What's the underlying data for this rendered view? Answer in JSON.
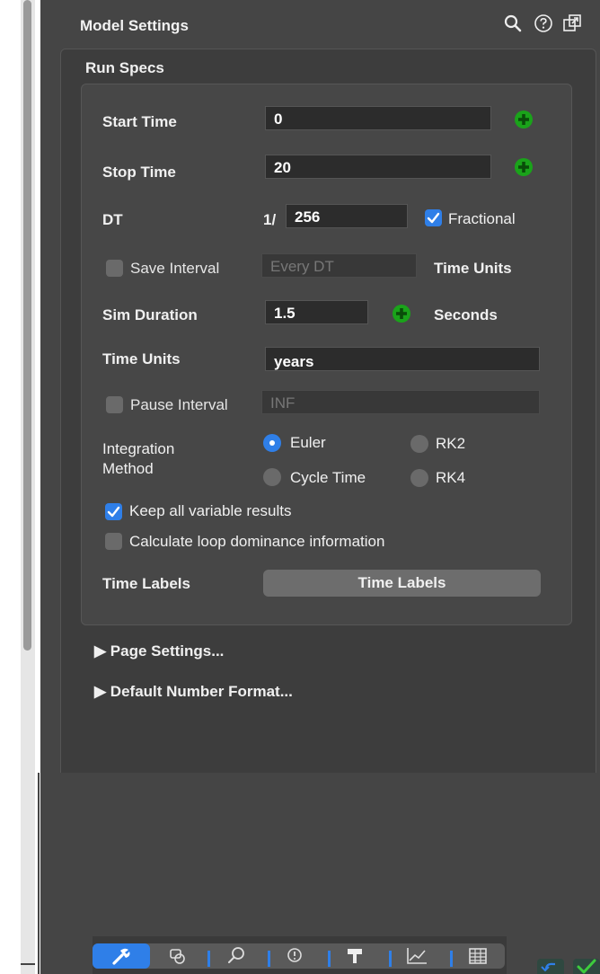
{
  "header": {
    "title": "Model Settings",
    "icons": [
      "search-icon",
      "help-icon",
      "popout-icon"
    ]
  },
  "run_specs": {
    "title": "Run Specs",
    "start_time": {
      "label": "Start Time",
      "value": "0"
    },
    "stop_time": {
      "label": "Stop Time",
      "value": "20"
    },
    "dt": {
      "label": "DT",
      "prefix": "1/",
      "value": "256",
      "fractional_label": "Fractional",
      "fractional_checked": true
    },
    "save_interval": {
      "label": "Save Interval",
      "placeholder": "Every DT",
      "units": "Time Units",
      "checked": false
    },
    "sim_duration": {
      "label": "Sim Duration",
      "value": "1.5",
      "units": "Seconds"
    },
    "time_units": {
      "label": "Time Units",
      "value": "years"
    },
    "pause_interval": {
      "label": "Pause Interval",
      "placeholder": "INF",
      "checked": false
    },
    "integration": {
      "label_line1": "Integration",
      "label_line2": "Method",
      "options": [
        "Euler",
        "RK2",
        "Cycle Time",
        "RK4"
      ],
      "selected": "Euler"
    },
    "keep_results": {
      "label": "Keep all variable results",
      "checked": true
    },
    "loop_dominance": {
      "label": "Calculate loop dominance information",
      "checked": false
    },
    "time_labels": {
      "label": "Time Labels",
      "button": "Time Labels"
    }
  },
  "sections": {
    "page_settings": "▶ Page Settings...",
    "default_number_format": "▶ Default Number Format..."
  },
  "toolbar": {
    "items": [
      "wrench-icon",
      "shapes-icon",
      "search-magnify-icon",
      "warning-icon",
      "format-icon",
      "graph-icon",
      "table-icon"
    ],
    "active": "wrench-icon"
  },
  "colors": {
    "panel": "#454545",
    "accent": "#2f7fe8",
    "plus_green": "#1aa31a"
  }
}
